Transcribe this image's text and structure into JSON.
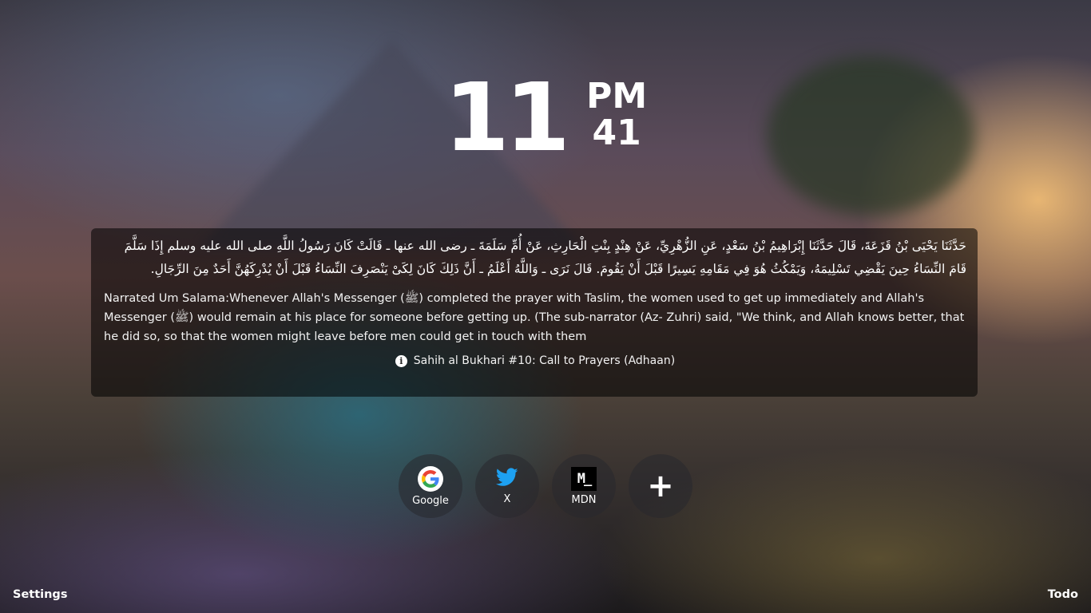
{
  "clock": {
    "hour": "11",
    "ampm": "PM",
    "minute": "41"
  },
  "hadith": {
    "arabic": "حَدَّثَنَا يَحْيَى بْنُ قَزَعَةَ، قَالَ حَدَّثَنَا إِبْرَاهِيمُ بْنُ سَعْدٍ، عَنِ الزُّهْرِيِّ، عَنْ هِنْدٍ بِنْتِ الْحَارِثِ، عَنْ أُمِّ سَلَمَةَ ـ رضى الله عنها ـ قَالَتْ كَانَ رَسُولُ اللَّهِ صلى الله عليه وسلم إِذَا سَلَّمَ قَامَ النِّسَاءُ حِينَ يَقْضِي تَسْلِيمَهُ، وَيَمْكُثُ هُوَ فِي مَقَامِهِ يَسِيرًا قَبْلَ أَنْ يَقُومَ‏.‏ قَالَ نَرَى ـ وَاللَّهُ أَعْلَمُ ـ أَنَّ ذَلِكَ كَانَ لِكَىْ يَنْصَرِفَ النِّسَاءُ قَبْلَ أَنْ يُدْرِكَهُنَّ أَحَدٌ مِنَ الرِّجَالِ‏.",
    "english": "Narrated Um Salama:Whenever Allah's Messenger (ﷺ) completed the prayer with Taslim, the women used to get up immediately and Allah's Messenger (ﷺ) would remain at his place for someone before getting up. (The sub-narrator (Az- Zuhri) said, \"We think, and Allah knows better, that he did so, so that the women might leave before men could get in touch with them",
    "source": "Sahih al Bukhari #10: Call to Prayers (Adhaan)",
    "source_icon": "info-icon"
  },
  "shortcuts": [
    {
      "label": "Google",
      "icon": "google-icon"
    },
    {
      "label": "X",
      "icon": "twitter-icon"
    },
    {
      "label": "MDN",
      "icon": "mdn-icon",
      "icon_text": "M_"
    },
    {
      "label": "",
      "icon": "add-icon",
      "icon_text": "+"
    }
  ],
  "footer": {
    "settings_label": "Settings",
    "todo_label": "Todo"
  },
  "colors": {
    "card_background": "rgba(0,0,0,0.55)",
    "text": "#ffffff",
    "twitter_blue": "#1DA1F2"
  }
}
